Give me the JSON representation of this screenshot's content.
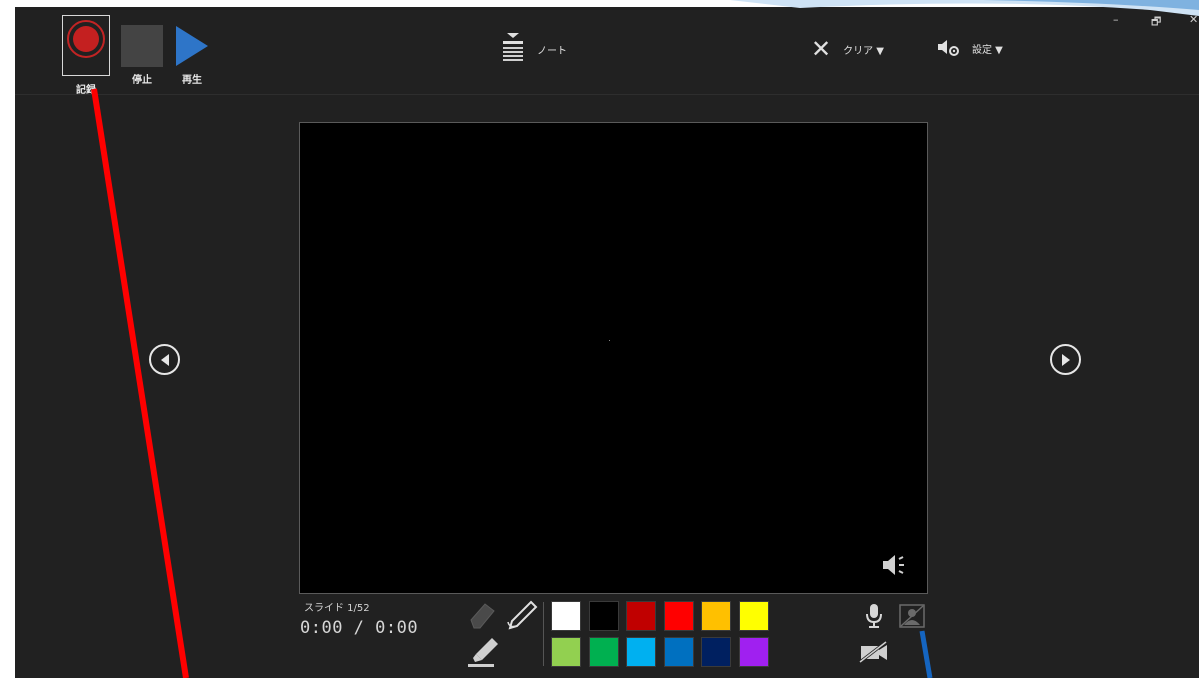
{
  "toolbar": {
    "record_label": "記録",
    "stop_label": "停止",
    "play_label": "再生",
    "notes_label": "ノート",
    "clear_label": "クリア ▼",
    "settings_label": "設定 ▼"
  },
  "window": {
    "minimize": "–",
    "restore": "🗗",
    "close": "✕"
  },
  "slide": {
    "counter": "スライド 1/52",
    "timer": "0:00 / 0:00"
  },
  "pen_colors_row1": [
    "#ffffff",
    "#000000",
    "#c00000",
    "#ff0000",
    "#ffc000",
    "#ffff00"
  ],
  "pen_colors_row2": [
    "#92d050",
    "#00b050",
    "#00b0f0",
    "#0070c0",
    "#002060",
    "#a020f0"
  ],
  "colors": {
    "accent_blue": "#2e75c8",
    "record_red": "#c42020",
    "annotation_red": "#ff0000",
    "annotation_blue": "#1565c0"
  }
}
